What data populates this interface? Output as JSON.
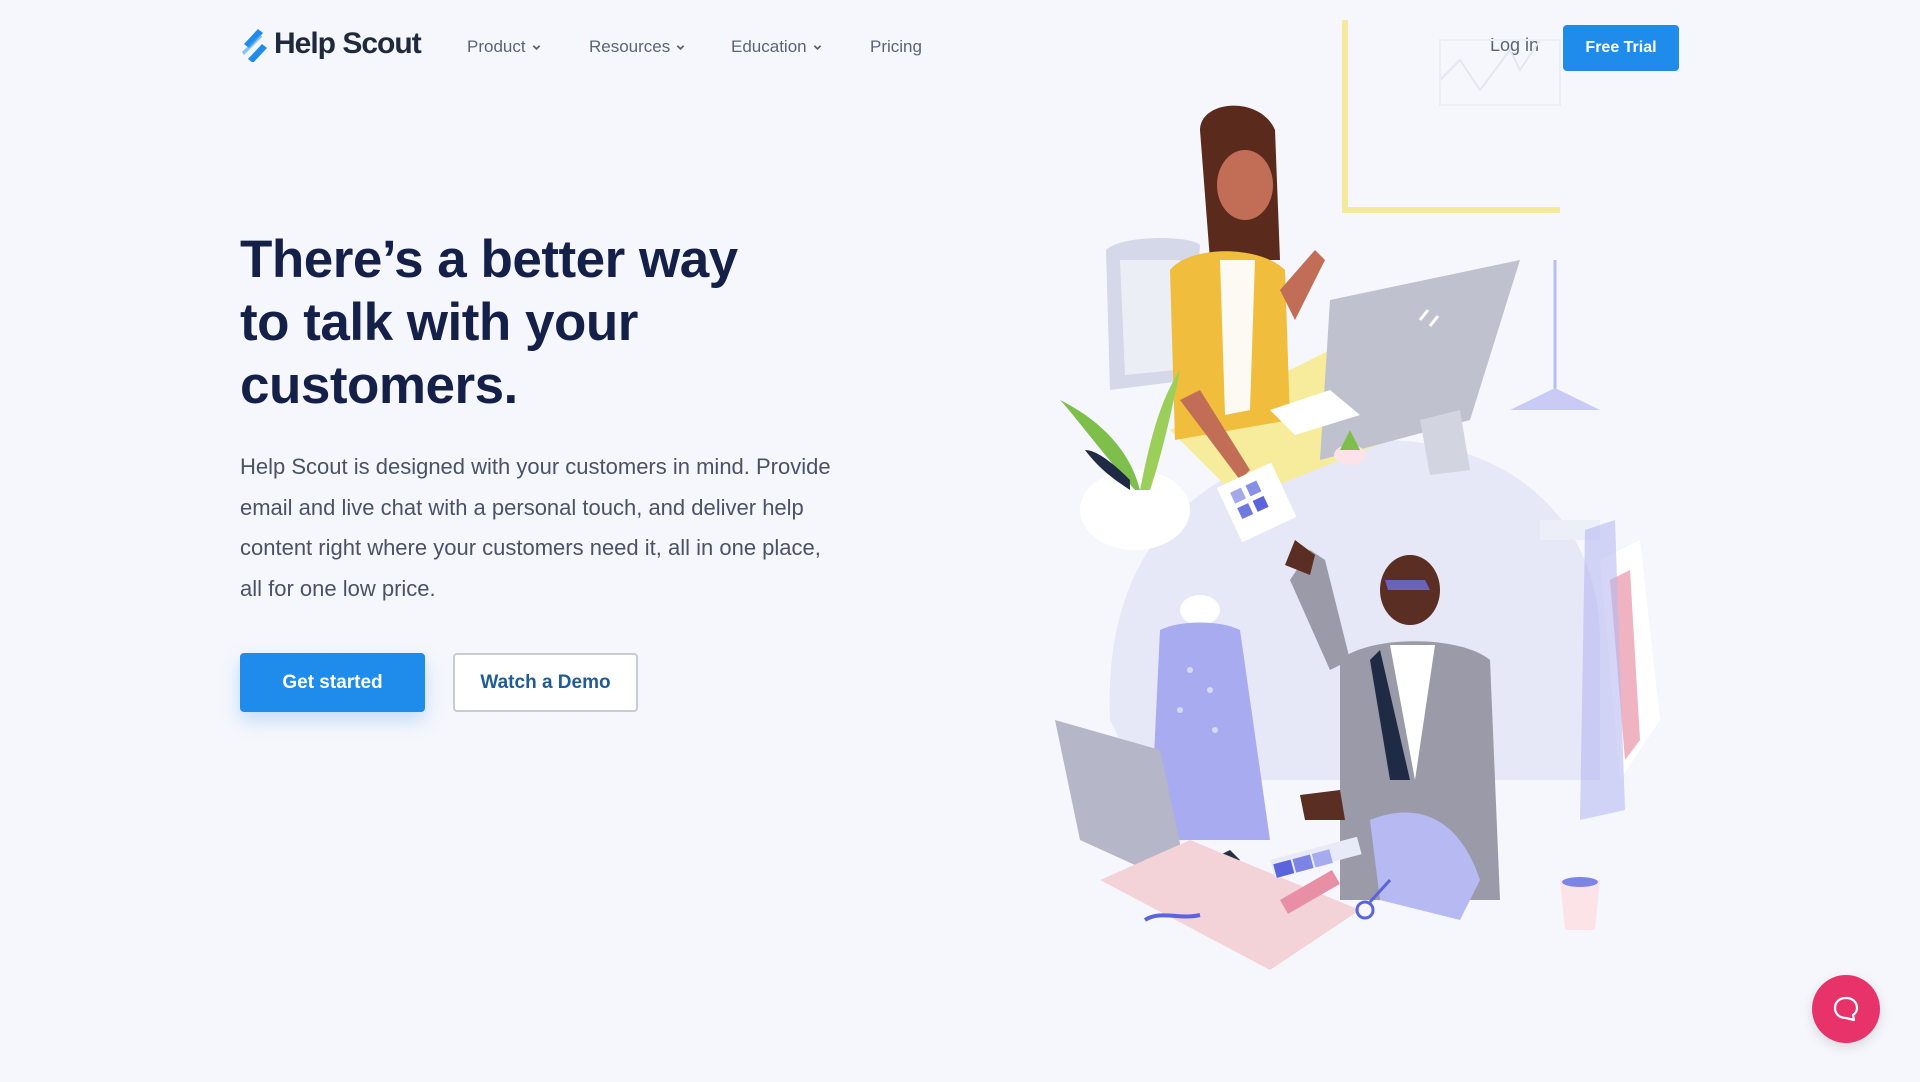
{
  "nav": {
    "brand": "Help Scout",
    "logo_icon": "help-scout-slashes-icon",
    "menu": [
      {
        "label": "Product",
        "has_dropdown": true
      },
      {
        "label": "Resources",
        "has_dropdown": true
      },
      {
        "label": "Education",
        "has_dropdown": true
      },
      {
        "label": "Pricing",
        "has_dropdown": false
      }
    ],
    "login_label": "Log in",
    "cta_label": "Free Trial"
  },
  "hero": {
    "title_lines": [
      "There’s a better way",
      "to talk with your",
      "customers."
    ],
    "description": "Help Scout is designed with your customers in mind. Provide email and live chat with a personal touch, and deliver help content right where your customers need it, all in one place, all for one low price.",
    "primary_cta": "Get started",
    "secondary_cta": "Watch a Demo"
  },
  "illustration": {
    "description": "Two people working: woman at desk with computer, man in tailoring studio with laptop and fabric swatches"
  },
  "beacon": {
    "icon": "chat-bubble-icon"
  },
  "colors": {
    "brand_blue": "#1f8ceb",
    "heading_navy": "#142048",
    "body_gray": "#4a5265",
    "beacon_pink": "#e8336a",
    "background": "#f6f7fd"
  }
}
